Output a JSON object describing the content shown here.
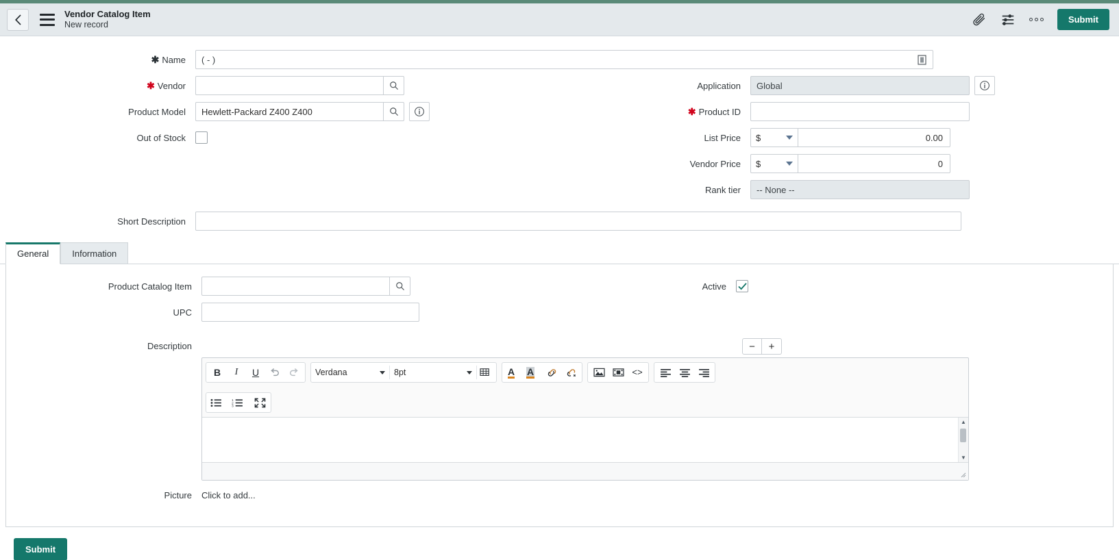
{
  "header": {
    "title": "Vendor Catalog Item",
    "subtitle": "New record",
    "back_icon": "chevron-left-icon",
    "menu_icon": "hamburger-icon",
    "attachment_icon": "paperclip-icon",
    "personalize_icon": "sliders-icon",
    "more_icon": "ellipsis-icon",
    "submit_label": "Submit"
  },
  "colors": {
    "accent": "#15786b",
    "top_strip": "#5a8a78",
    "header_bg": "#e4e9ec",
    "required_star": "#d0021b",
    "readonly_bg": "#e3e8eb"
  },
  "form": {
    "name": {
      "label": "Name",
      "value": "( - )",
      "required": true,
      "required_filled": true,
      "end_icon": "reference-icon"
    },
    "vendor": {
      "label": "Vendor",
      "value": "",
      "placeholder": "",
      "required": true,
      "lookup_icon": "magnifier-icon"
    },
    "product_model": {
      "label": "Product Model",
      "value": "Hewlett-Packard Z400 Z400",
      "lookup_icon": "magnifier-icon",
      "info_icon": "info-circle-icon"
    },
    "out_of_stock": {
      "label": "Out of Stock",
      "checked": false
    },
    "application": {
      "label": "Application",
      "value": "Global",
      "readonly": true,
      "info_icon": "info-circle-icon"
    },
    "product_id": {
      "label": "Product ID",
      "value": "",
      "required": true
    },
    "list_price": {
      "label": "List Price",
      "currency": "$",
      "value": "0.00"
    },
    "vendor_price": {
      "label": "Vendor Price",
      "currency": "$",
      "value": "0"
    },
    "rank_tier": {
      "label": "Rank tier",
      "value": "-- None --",
      "readonly": true
    },
    "short_description": {
      "label": "Short Description",
      "value": ""
    }
  },
  "tabs": [
    {
      "label": "General",
      "active": true
    },
    {
      "label": "Information",
      "active": false
    }
  ],
  "general_tab": {
    "product_catalog_item": {
      "label": "Product Catalog Item",
      "value": "",
      "lookup_icon": "magnifier-icon"
    },
    "upc": {
      "label": "UPC",
      "value": ""
    },
    "active": {
      "label": "Active",
      "checked": true
    },
    "description": {
      "label": "Description",
      "value": ""
    },
    "picture": {
      "label": "Picture",
      "link_text": "Click to add..."
    }
  },
  "editor": {
    "zoom_out_label": "−",
    "zoom_in_label": "+",
    "font_family": "Verdana",
    "font_size": "8pt",
    "buttons": {
      "bold": "B",
      "italic": "I",
      "underline": "U",
      "undo": "undo-icon",
      "redo": "redo-icon",
      "table": "table-icon",
      "text_color": "A",
      "highlight_color": "A",
      "link": "link-icon",
      "unlink": "unlink-icon",
      "image": "image-icon",
      "video": "video-icon",
      "source": "<>",
      "align_left": "align-left-icon",
      "align_center": "align-center-icon",
      "align_right": "align-right-icon",
      "bullet_list": "bullet-list-icon",
      "numbered_list": "numbered-list-icon",
      "fullscreen": "fullscreen-icon"
    }
  },
  "footer": {
    "submit_label": "Submit"
  }
}
